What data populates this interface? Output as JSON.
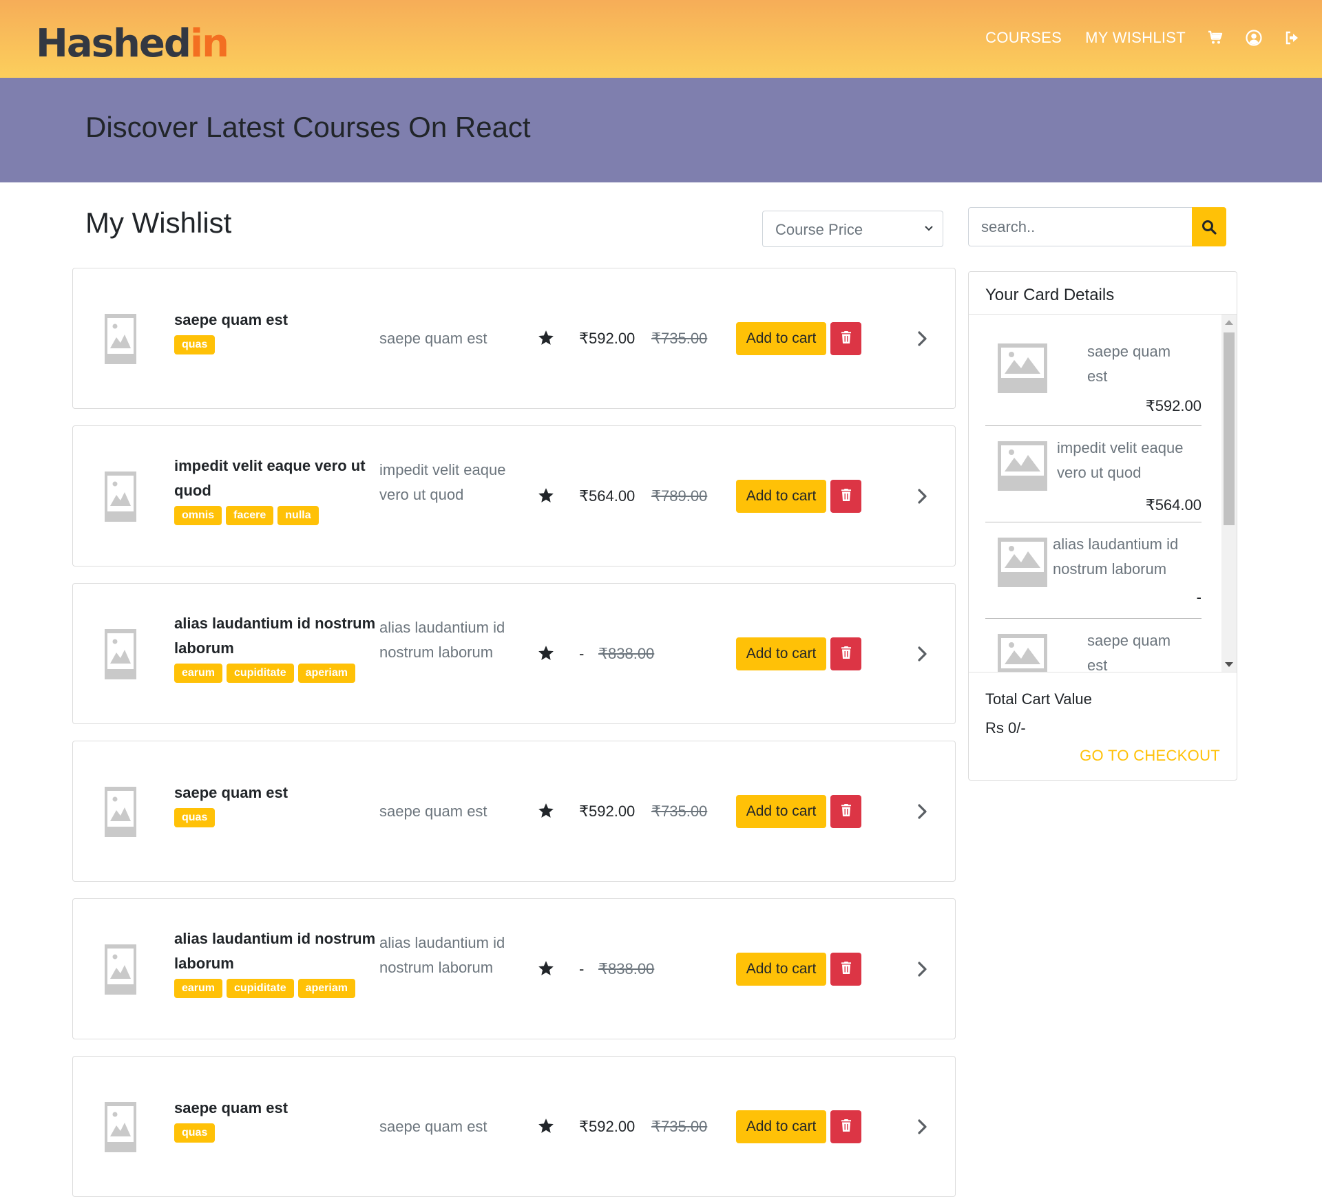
{
  "header": {
    "logo_text_a": "Hashed",
    "logo_text_b": "in",
    "nav": {
      "courses": "COURSES",
      "wishlist": "MY WISHLIST"
    },
    "icons": [
      "cart-icon",
      "user-circle-icon",
      "sign-out-icon"
    ]
  },
  "banner": {
    "title": "Discover Latest Courses On React"
  },
  "wishlist": {
    "title": "My Wishlist",
    "sort": {
      "selected": "Course Price"
    },
    "search": {
      "placeholder": "search.."
    },
    "items": [
      {
        "name": "saepe quam est",
        "tags": [
          "quas"
        ],
        "author": "saepe quam est",
        "price": "₹592.00",
        "old_price": "₹735.00",
        "cart_label": "Add to cart"
      },
      {
        "name": "impedit velit eaque vero ut quod",
        "tags": [
          "omnis",
          "facere",
          "nulla"
        ],
        "author": "impedit velit eaque vero ut quod",
        "price": "₹564.00",
        "old_price": "₹789.00",
        "cart_label": "Add to cart"
      },
      {
        "name": "alias laudantium id nostrum laborum",
        "tags": [
          "earum",
          "cupiditate",
          "aperiam"
        ],
        "author": "alias laudantium id nostrum laborum",
        "price": "-",
        "old_price": "₹838.00",
        "cart_label": "Add to cart"
      },
      {
        "name": "saepe quam est",
        "tags": [
          "quas"
        ],
        "author": "saepe quam est",
        "price": "₹592.00",
        "old_price": "₹735.00",
        "cart_label": "Add to cart"
      },
      {
        "name": "alias laudantium id nostrum laborum",
        "tags": [
          "earum",
          "cupiditate",
          "aperiam"
        ],
        "author": "alias laudantium id nostrum laborum",
        "price": "-",
        "old_price": "₹838.00",
        "cart_label": "Add to cart"
      },
      {
        "name": "saepe quam est",
        "tags": [
          "quas"
        ],
        "author": "saepe quam est",
        "price": "₹592.00",
        "old_price": "₹735.00",
        "cart_label": "Add to cart"
      }
    ]
  },
  "cart": {
    "title": "Your Card Details",
    "items": [
      {
        "name": "saepe quam est",
        "price": "₹592.00"
      },
      {
        "name": "impedit velit eaque vero ut quod",
        "price": "₹564.00"
      },
      {
        "name": "alias laudantium id nostrum laborum",
        "price": "-"
      },
      {
        "name": "saepe quam est",
        "price": ""
      }
    ],
    "total_label": "Total Cart Value",
    "total_value": "Rs 0/-",
    "checkout_label": "GO TO CHECKOUT"
  },
  "colors": {
    "accent": "#ffc107",
    "danger": "#dc3545",
    "banner": "#7f7fae",
    "header_top": "#f6ad58",
    "header_bottom": "#fccf5c"
  }
}
